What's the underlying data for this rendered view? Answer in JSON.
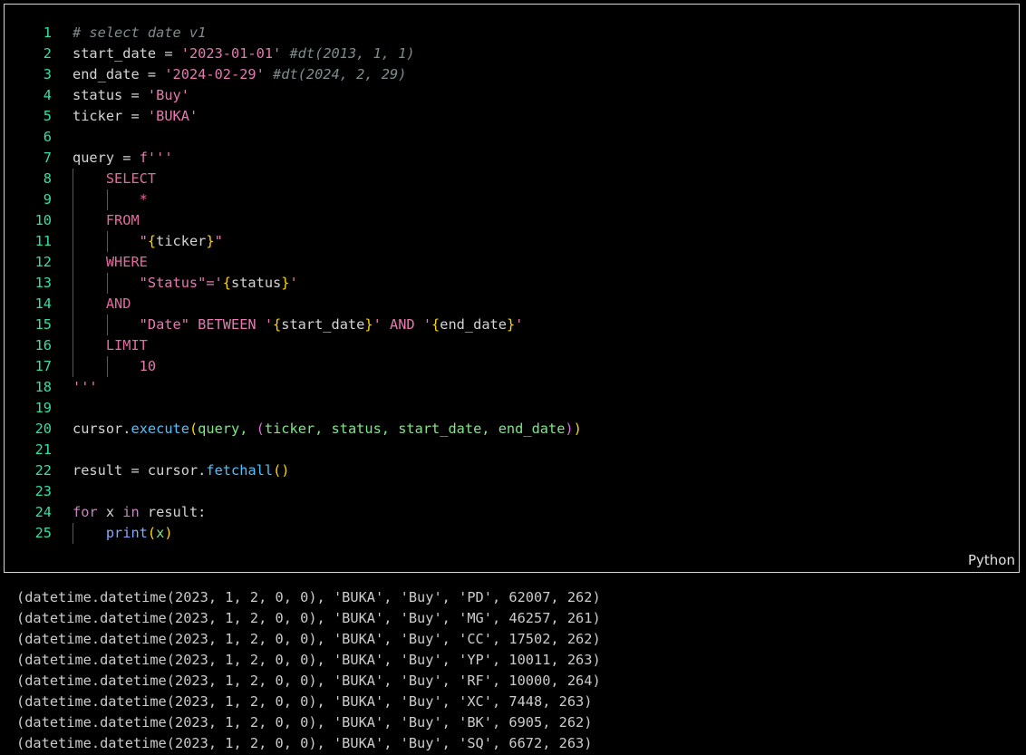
{
  "cell": {
    "language": "Python",
    "lines": [
      {
        "n": "1",
        "tokens": [
          {
            "t": "# select date v1",
            "c": "t-comment"
          }
        ]
      },
      {
        "n": "2",
        "tokens": [
          {
            "t": "start_date",
            "c": "t-plain"
          },
          {
            "t": " = ",
            "c": "t-plain"
          },
          {
            "t": "'2023-01-01'",
            "c": "t-strq"
          },
          {
            "t": " #dt(2013, 1, 1)",
            "c": "t-comment"
          }
        ]
      },
      {
        "n": "3",
        "tokens": [
          {
            "t": "end_date",
            "c": "t-plain"
          },
          {
            "t": " = ",
            "c": "t-plain"
          },
          {
            "t": "'2024-02-29'",
            "c": "t-strq"
          },
          {
            "t": " #dt(2024, 2, 29)",
            "c": "t-comment"
          }
        ]
      },
      {
        "n": "4",
        "tokens": [
          {
            "t": "status",
            "c": "t-plain"
          },
          {
            "t": " = ",
            "c": "t-plain"
          },
          {
            "t": "'Buy'",
            "c": "t-strq"
          }
        ]
      },
      {
        "n": "5",
        "tokens": [
          {
            "t": "ticker",
            "c": "t-plain"
          },
          {
            "t": " = ",
            "c": "t-plain"
          },
          {
            "t": "'BUKA'",
            "c": "t-strq"
          }
        ]
      },
      {
        "n": "6",
        "tokens": []
      },
      {
        "n": "7",
        "tokens": [
          {
            "t": "query",
            "c": "t-plain"
          },
          {
            "t": " = ",
            "c": "t-plain"
          },
          {
            "t": "f'''",
            "c": "t-strq"
          }
        ]
      },
      {
        "n": "8",
        "indent": 1,
        "tokens": [
          {
            "t": "    SELECT",
            "c": "t-sql"
          }
        ]
      },
      {
        "n": "9",
        "indent": 2,
        "tokens": [
          {
            "t": "        *",
            "c": "t-sql"
          }
        ]
      },
      {
        "n": "10",
        "indent": 1,
        "tokens": [
          {
            "t": "    FROM",
            "c": "t-sql"
          }
        ]
      },
      {
        "n": "11",
        "indent": 2,
        "tokens": [
          {
            "t": "        \"",
            "c": "t-strq"
          },
          {
            "t": "{",
            "c": "t-brace"
          },
          {
            "t": "ticker",
            "c": "t-plain"
          },
          {
            "t": "}",
            "c": "t-brace"
          },
          {
            "t": "\"",
            "c": "t-strq"
          }
        ]
      },
      {
        "n": "12",
        "indent": 1,
        "tokens": [
          {
            "t": "    WHERE",
            "c": "t-sql"
          }
        ]
      },
      {
        "n": "13",
        "indent": 2,
        "tokens": [
          {
            "t": "        \"Status\"='",
            "c": "t-strq"
          },
          {
            "t": "{",
            "c": "t-brace"
          },
          {
            "t": "status",
            "c": "t-plain"
          },
          {
            "t": "}",
            "c": "t-brace"
          },
          {
            "t": "'",
            "c": "t-strq"
          }
        ]
      },
      {
        "n": "14",
        "indent": 1,
        "tokens": [
          {
            "t": "    AND",
            "c": "t-sql"
          }
        ]
      },
      {
        "n": "15",
        "indent": 2,
        "tokens": [
          {
            "t": "        \"Date\" BETWEEN '",
            "c": "t-strq"
          },
          {
            "t": "{",
            "c": "t-brace"
          },
          {
            "t": "start_date",
            "c": "t-plain"
          },
          {
            "t": "}",
            "c": "t-brace"
          },
          {
            "t": "' AND '",
            "c": "t-strq"
          },
          {
            "t": "{",
            "c": "t-brace"
          },
          {
            "t": "end_date",
            "c": "t-plain"
          },
          {
            "t": "}",
            "c": "t-brace"
          },
          {
            "t": "'",
            "c": "t-strq"
          }
        ]
      },
      {
        "n": "16",
        "indent": 1,
        "tokens": [
          {
            "t": "    LIMIT",
            "c": "t-sql"
          }
        ]
      },
      {
        "n": "17",
        "indent": 2,
        "tokens": [
          {
            "t": "        10",
            "c": "t-strq"
          }
        ]
      },
      {
        "n": "18",
        "tokens": [
          {
            "t": "'''",
            "c": "t-strq"
          }
        ]
      },
      {
        "n": "19",
        "tokens": []
      },
      {
        "n": "20",
        "tokens": [
          {
            "t": "cursor",
            "c": "t-plain"
          },
          {
            "t": ".",
            "c": "t-plain"
          },
          {
            "t": "execute",
            "c": "t-fn"
          },
          {
            "t": "(",
            "c": "t-paren1"
          },
          {
            "t": "query, ",
            "c": "t-arg"
          },
          {
            "t": "(",
            "c": "t-paren2"
          },
          {
            "t": "ticker, status, start_date, end_date",
            "c": "t-arg"
          },
          {
            "t": ")",
            "c": "t-paren2"
          },
          {
            "t": ")",
            "c": "t-paren1"
          }
        ]
      },
      {
        "n": "21",
        "tokens": []
      },
      {
        "n": "22",
        "tokens": [
          {
            "t": "result",
            "c": "t-plain"
          },
          {
            "t": " = ",
            "c": "t-plain"
          },
          {
            "t": "cursor",
            "c": "t-plain"
          },
          {
            "t": ".",
            "c": "t-plain"
          },
          {
            "t": "fetchall",
            "c": "t-fn"
          },
          {
            "t": "()",
            "c": "t-paren1"
          }
        ]
      },
      {
        "n": "23",
        "tokens": []
      },
      {
        "n": "24",
        "tokens": [
          {
            "t": "for",
            "c": "t-kw"
          },
          {
            "t": " x ",
            "c": "t-plain"
          },
          {
            "t": "in",
            "c": "t-kw"
          },
          {
            "t": " result:",
            "c": "t-plain"
          }
        ]
      },
      {
        "n": "25",
        "indent": 1,
        "tokens": [
          {
            "t": "    ",
            "c": "t-plain"
          },
          {
            "t": "print",
            "c": "t-fn2"
          },
          {
            "t": "(",
            "c": "t-paren1"
          },
          {
            "t": "x",
            "c": "t-arg"
          },
          {
            "t": ")",
            "c": "t-paren1"
          }
        ]
      }
    ]
  },
  "output": [
    "(datetime.datetime(2023, 1, 2, 0, 0), 'BUKA', 'Buy', 'PD', 62007, 262)",
    "(datetime.datetime(2023, 1, 2, 0, 0), 'BUKA', 'Buy', 'MG', 46257, 261)",
    "(datetime.datetime(2023, 1, 2, 0, 0), 'BUKA', 'Buy', 'CC', 17502, 262)",
    "(datetime.datetime(2023, 1, 2, 0, 0), 'BUKA', 'Buy', 'YP', 10011, 263)",
    "(datetime.datetime(2023, 1, 2, 0, 0), 'BUKA', 'Buy', 'RF', 10000, 264)",
    "(datetime.datetime(2023, 1, 2, 0, 0), 'BUKA', 'Buy', 'XC', 7448, 263)",
    "(datetime.datetime(2023, 1, 2, 0, 0), 'BUKA', 'Buy', 'BK', 6905, 262)",
    "(datetime.datetime(2023, 1, 2, 0, 0), 'BUKA', 'Buy', 'SQ', 6672, 263)"
  ]
}
